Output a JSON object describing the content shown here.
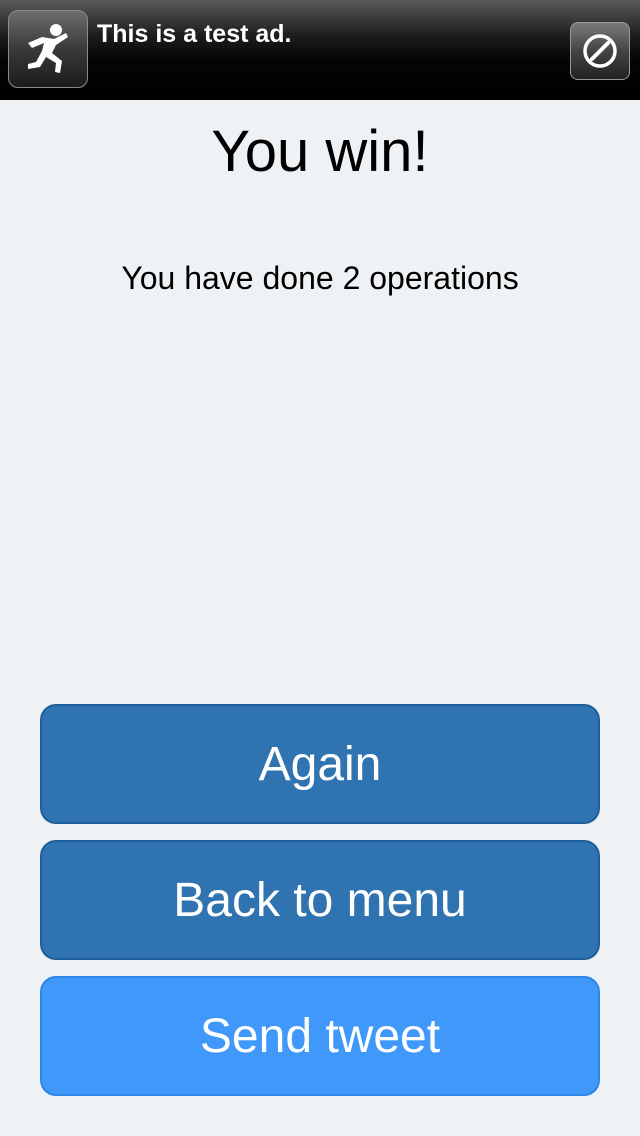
{
  "ad": {
    "text": "This is a test ad.",
    "icon": "running-figure-icon",
    "action_icon": "compass-icon"
  },
  "result": {
    "title": "You win!",
    "summary": "You have done 2 operations"
  },
  "buttons": {
    "again": "Again",
    "back_to_menu": "Back to menu",
    "send_tweet": "Send tweet"
  },
  "colors": {
    "background": "#eff2f5",
    "button_primary": "#2f74b0",
    "button_tweet": "#3f98fa",
    "ad_background": "#000000"
  }
}
